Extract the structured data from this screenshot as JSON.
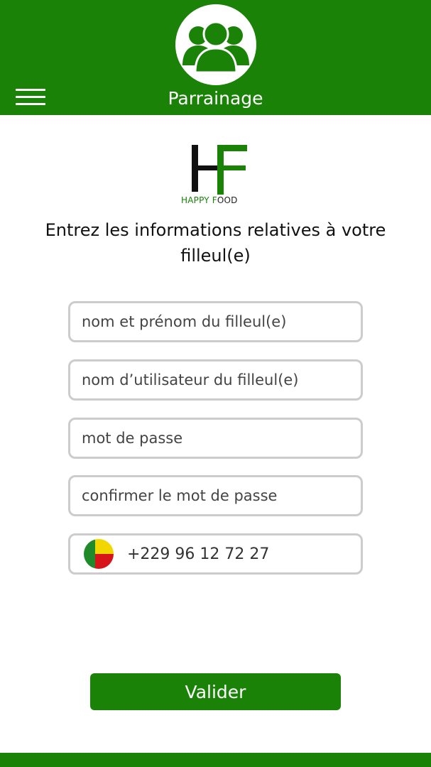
{
  "header": {
    "title": "Parrainage",
    "menu_icon": "hamburger-menu-icon",
    "avatar_icon": "users-group-icon",
    "background_color": "#1a8207"
  },
  "logo": {
    "text_happy": "HAPPY F",
    "text_food": "OOD",
    "colors": {
      "green": "#1a8207",
      "black": "#111111"
    }
  },
  "instruction": "Entrez les informations relatives à votre filleul(e)",
  "form": {
    "full_name": {
      "placeholder": "nom et prénom du filleul(e)",
      "value": ""
    },
    "username": {
      "placeholder": "nom d’utilisateur du filleul(e)",
      "value": ""
    },
    "password": {
      "placeholder": "mot de passe",
      "value": ""
    },
    "confirm_password": {
      "placeholder": "confirmer le mot de passe",
      "value": ""
    },
    "phone": {
      "value": "+229 96 12 72 27",
      "country_flag": "benin-flag-icon"
    }
  },
  "submit_label": "Valider"
}
